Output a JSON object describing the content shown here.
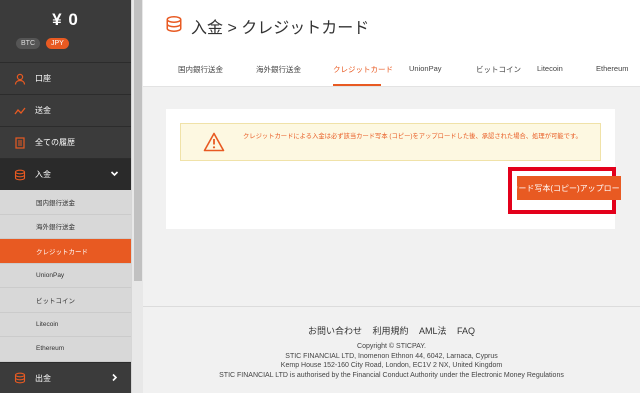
{
  "sidebar": {
    "balance": "¥ 0",
    "currencies": {
      "btc": "BTC",
      "jpy": "JPY"
    },
    "nav": {
      "account": "口座",
      "transfer": "送金",
      "history": "全ての履歴",
      "deposit": "入金",
      "withdraw": "出金"
    },
    "submenu": [
      "国内銀行送金",
      "海外銀行送金",
      "クレジットカード",
      "UnionPay",
      "ビットコイン",
      "Litecoin",
      "Ethereum"
    ]
  },
  "header": {
    "title": "入金 > クレジットカード",
    "tabs": [
      "国内銀行送金",
      "海外銀行送金",
      "クレジットカード",
      "UnionPay",
      "ビットコイン",
      "Litecoin",
      "Ethereum"
    ],
    "active_tab": "クレジットカード"
  },
  "content": {
    "warning": "クレジットカードによる入金は必ず該当カード写本 (コピー)をアップロードした後、承認された場合、処理が可能です。",
    "upload_button": "カード写本(コピー)アップロード"
  },
  "footer": {
    "links": [
      "お問い合わせ",
      "利用規約",
      "AML法",
      "FAQ"
    ],
    "lines": [
      "Copyright © STICPAY.",
      "STIC FINANCIAL LTD, Inomenon Ethnon 44, 6042, Larnaca, Cyprus",
      "Kemp House 152-160 City Road, London, EC1V 2 NX, United Kingdom",
      "STIC FINANCIAL LTD is authorised by the Financial Conduct Authority under the Electronic Money Regulations"
    ]
  },
  "colors": {
    "accent": "#e85a22",
    "sidebar_bg": "#3b3b3b",
    "highlight": "#e3001b"
  }
}
